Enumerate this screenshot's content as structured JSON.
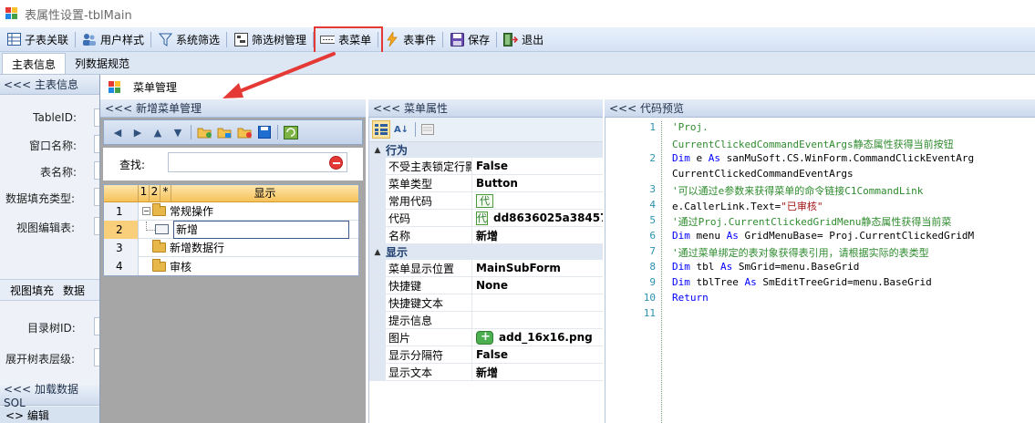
{
  "window": {
    "title": "表属性设置-tblMain"
  },
  "toolbar": {
    "items": [
      {
        "label": "子表关联",
        "icon": "table-link-icon"
      },
      {
        "label": "用户样式",
        "icon": "user-style-icon"
      },
      {
        "label": "系统筛选",
        "icon": "filter-icon"
      },
      {
        "label": "筛选树管理",
        "icon": "filter-tree-icon"
      },
      {
        "label": "表菜单",
        "icon": "table-menu-icon"
      },
      {
        "label": "表事件",
        "icon": "lightning-icon"
      },
      {
        "label": "保存",
        "icon": "save-icon"
      },
      {
        "label": "退出",
        "icon": "exit-icon"
      }
    ]
  },
  "tabs": [
    {
      "label": "主表信息",
      "active": true
    },
    {
      "label": "列数据规范",
      "active": false
    }
  ],
  "left_form": {
    "main_section": "<<< 主表信息",
    "fields": [
      "TableID:",
      "窗口名称:",
      "表名称:",
      "数据填充类型:",
      "视图编辑表:"
    ],
    "sub_tabs": [
      "视图填充",
      "数据"
    ],
    "fields2": [
      "目录树ID:",
      "展开树表层级:"
    ],
    "load_section": "<<< 加载数据 SQL",
    "edit_tab": "<> 编辑"
  },
  "dialog": {
    "title": "菜单管理",
    "tree_panel": {
      "header": "<<< 新增菜单管理",
      "search_label": "查找:",
      "grid_headers": [
        "",
        "1",
        "2",
        "*",
        "显示"
      ],
      "rows": [
        {
          "num": "1",
          "text": "常规操作",
          "kind": "folder-open"
        },
        {
          "num": "2",
          "text": "新增",
          "kind": "menu-item",
          "selected": true
        },
        {
          "num": "3",
          "text": "新增数据行",
          "kind": "folder"
        },
        {
          "num": "4",
          "text": "审核",
          "kind": "folder"
        }
      ]
    },
    "prop_panel": {
      "header": "<<< 菜单属性",
      "categories": [
        {
          "name": "行为",
          "rows": [
            {
              "name": "不受主表锁定行影",
              "value": "False"
            },
            {
              "name": "菜单类型",
              "value": "Button"
            },
            {
              "name": "常用代码",
              "value": "",
              "tag": "代"
            },
            {
              "name": "代码",
              "value": "dd8636025a38457",
              "tag": "代"
            },
            {
              "name": "名称",
              "value": "新增"
            }
          ]
        },
        {
          "name": "显示",
          "rows": [
            {
              "name": "菜单显示位置",
              "value": "MainSubForm"
            },
            {
              "name": "快捷键",
              "value": "None"
            },
            {
              "name": "快捷键文本",
              "value": ""
            },
            {
              "name": "提示信息",
              "value": ""
            },
            {
              "name": "图片",
              "value": "add_16x16.png",
              "image": true
            },
            {
              "name": "显示分隔符",
              "value": "False"
            },
            {
              "name": "显示文本",
              "value": "新增"
            }
          ]
        }
      ]
    },
    "code_panel": {
      "header": "<<< 代码预览",
      "lines": [
        {
          "num": "1",
          "segments": [
            {
              "t": "'Proj.",
              "c": "com"
            }
          ]
        },
        {
          "num": "",
          "segments": [
            {
              "t": "CurrentClickedCommandEventArgs静态属性获得当前按钮",
              "c": "com"
            }
          ]
        },
        {
          "num": "2",
          "segments": [
            {
              "t": "Dim",
              "c": "kw"
            },
            {
              "t": " e ",
              "c": "plain"
            },
            {
              "t": "As",
              "c": "kw"
            },
            {
              "t": " sanMuSoft.CS.WinForm.CommandClickEventArg",
              "c": "plain"
            }
          ]
        },
        {
          "num": "",
          "segments": [
            {
              "t": "CurrentClickedCommandEventArgs",
              "c": "plain"
            }
          ]
        },
        {
          "num": "3",
          "segments": [
            {
              "t": "'可以通过e参数来获得菜单的命令链接C1CommandLink",
              "c": "com"
            }
          ]
        },
        {
          "num": "4",
          "segments": [
            {
              "t": "e.CallerLink.Text=",
              "c": "plain"
            },
            {
              "t": "\"已审核\"",
              "c": "str"
            }
          ]
        },
        {
          "num": "5",
          "segments": [
            {
              "t": "'通过Proj.CurrentClickedGridMenu静态属性获得当前菜",
              "c": "com"
            }
          ]
        },
        {
          "num": "6",
          "segments": [
            {
              "t": "Dim",
              "c": "kw"
            },
            {
              "t": " menu ",
              "c": "plain"
            },
            {
              "t": "As",
              "c": "kw"
            },
            {
              "t": " GridMenuBase= Proj.CurrentClickedGridM",
              "c": "plain"
            }
          ]
        },
        {
          "num": "7",
          "segments": [
            {
              "t": "'通过菜单绑定的表对象获得表引用，请根据实际的表类型",
              "c": "com"
            }
          ]
        },
        {
          "num": "8",
          "segments": [
            {
              "t": "Dim",
              "c": "kw"
            },
            {
              "t": " tbl ",
              "c": "plain"
            },
            {
              "t": "As",
              "c": "kw"
            },
            {
              "t": " SmGrid=menu.BaseGrid",
              "c": "plain"
            }
          ]
        },
        {
          "num": "9",
          "segments": [
            {
              "t": "Dim",
              "c": "kw"
            },
            {
              "t": " tblTree ",
              "c": "plain"
            },
            {
              "t": "As",
              "c": "kw"
            },
            {
              "t": " SmEditTreeGrid=menu.BaseGrid",
              "c": "plain"
            }
          ]
        },
        {
          "num": "10",
          "segments": [
            {
              "t": "Return",
              "c": "kw"
            }
          ]
        },
        {
          "num": "11",
          "segments": []
        }
      ]
    }
  },
  "colors": {
    "highlight": "#e53935",
    "grid_header": "#f6c25a",
    "comment": "#2e8b2e",
    "keyword": "#0000ff"
  }
}
